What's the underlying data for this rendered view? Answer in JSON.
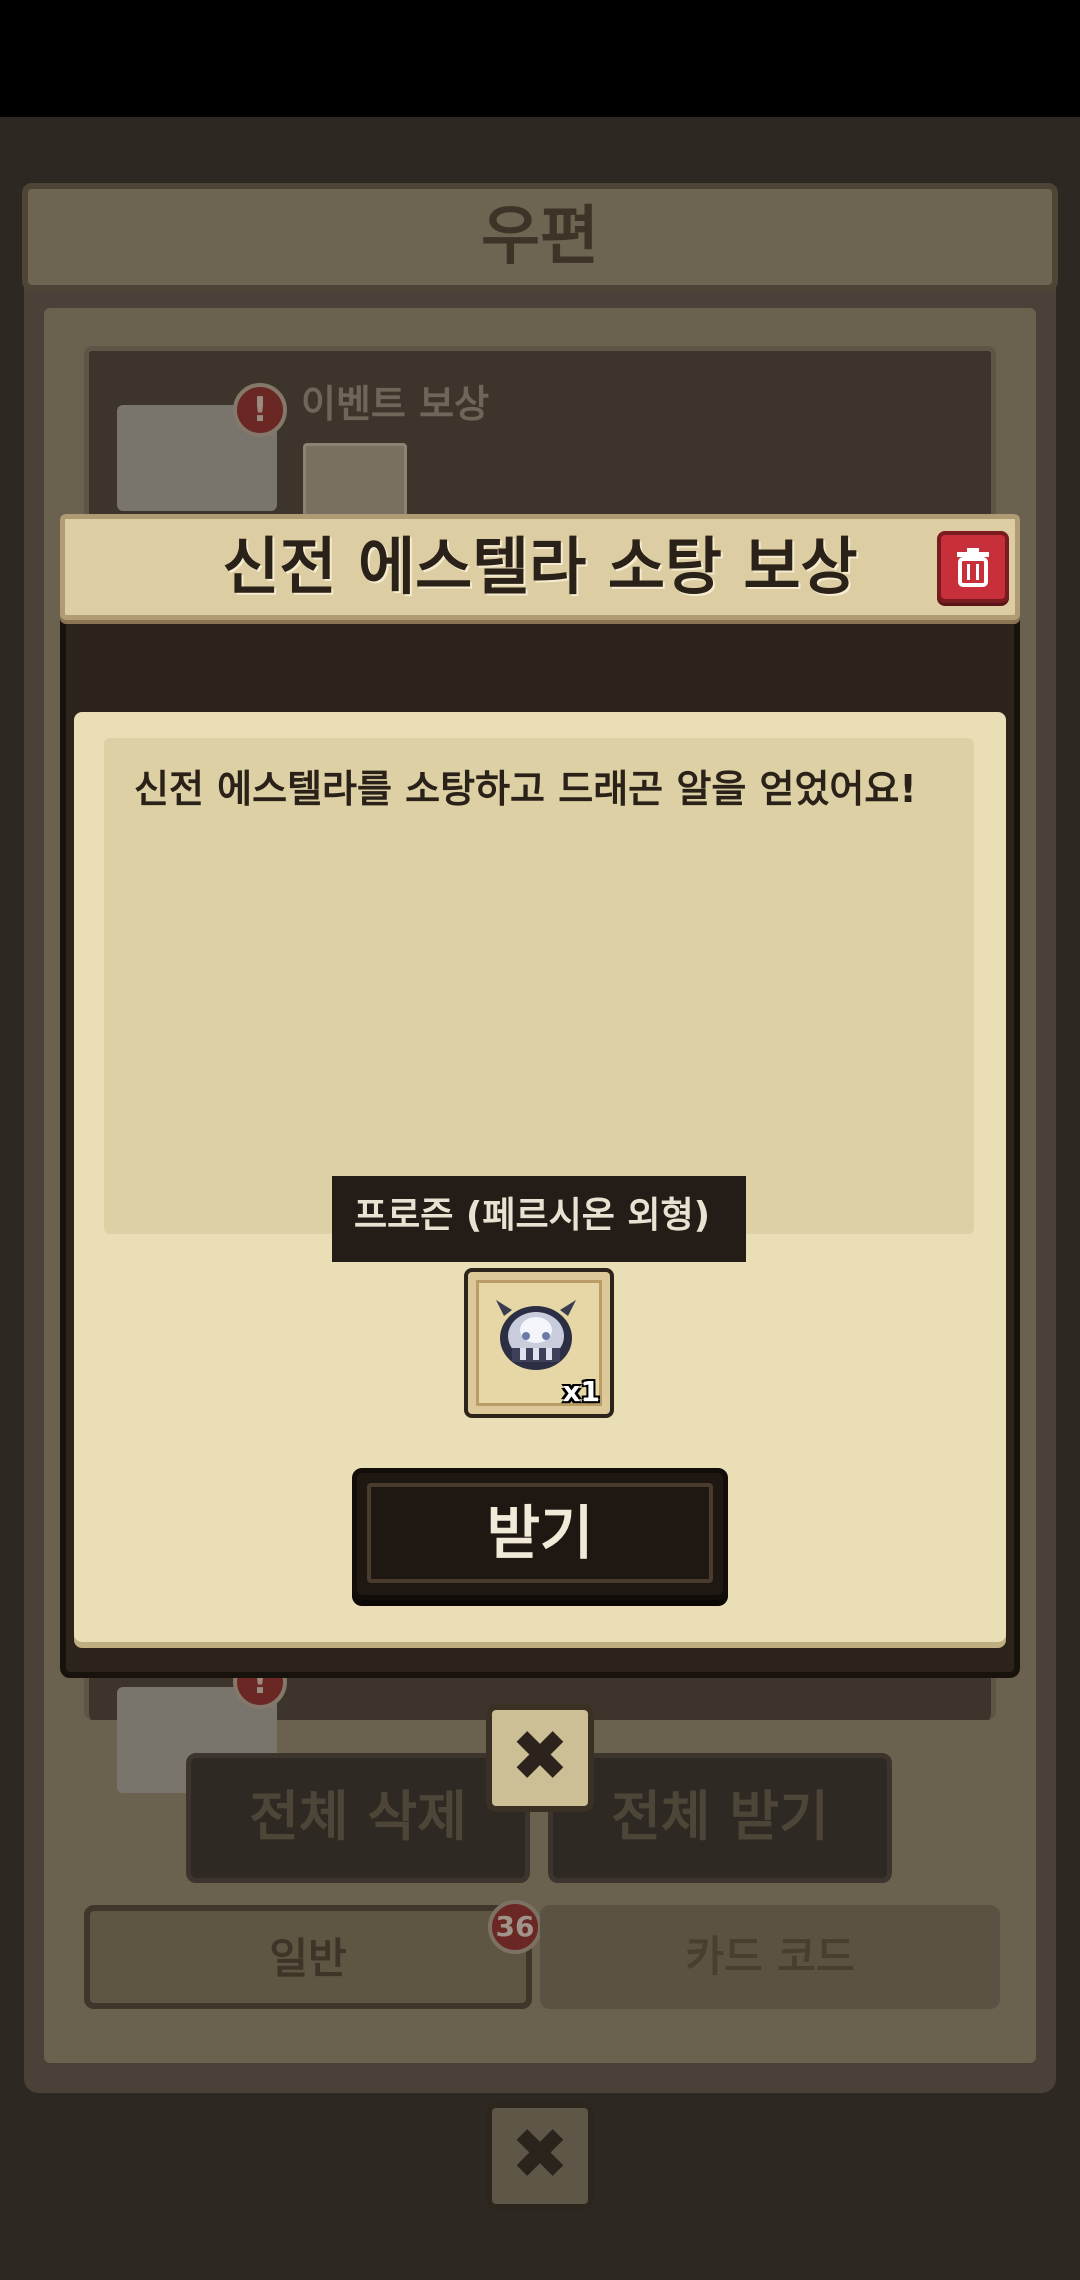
{
  "mailbox": {
    "title": "우편",
    "items": [
      {
        "title": "이벤트 보상",
        "alert": "!"
      },
      {
        "title": "",
        "alert": "!"
      }
    ],
    "delete_all_label": "전체 삭제",
    "claim_all_label": "전체 받기",
    "tabs": [
      {
        "label": "일반",
        "badge": "36"
      },
      {
        "label": "카드 코드"
      }
    ]
  },
  "dialog": {
    "title": "신전 에스텔라 소탕 보상",
    "message": "신전 에스텔라를 소탕하고 드래곤 알을 얻었어요!",
    "reward": {
      "name": "프로즌 (페르시온 외형)",
      "quantity": "x1",
      "icon": "frozen-dragon-helmet-icon"
    },
    "claim_label": "받기",
    "trash_icon": "trash-icon",
    "close_icon": "close-x-icon"
  },
  "colors": {
    "header_bg": "#dccda2",
    "body_bg": "#e9deb6",
    "trash_red": "#c7303a",
    "claim_bg": "#1f1812"
  }
}
